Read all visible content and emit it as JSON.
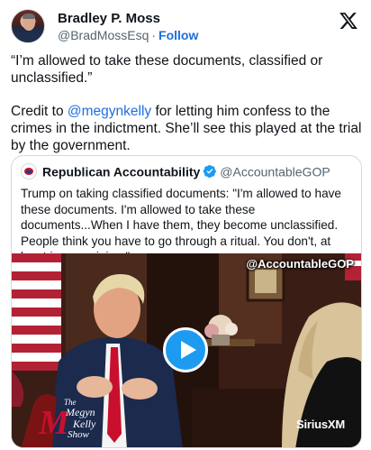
{
  "post": {
    "author_name": "Bradley P. Moss",
    "author_handle": "@BradMossEsq",
    "separator": "·",
    "follow_label": "Follow",
    "paragraph1": "“I’m allowed to take these documents, classified or unclassified.”",
    "paragraph2_prefix": "Credit to ",
    "paragraph2_mention": "@megynkelly",
    "paragraph2_suffix": " for letting him confess to the crimes in the indictment. She’ll see this played at the trial by the government."
  },
  "quoted": {
    "author_name": "Republican Accountability",
    "author_handle": "@AccountableGOP",
    "text": "Trump on taking classified documents: \"I'm allowed to have these documents. I'm allowed to take these documents...When I have them, they become unclassified. People think you have to go through a ritual. You don't, at least in my opinion.\"",
    "video": {
      "watermark": "@AccountableGOP",
      "show_logo_line1": "The",
      "show_logo_line2": "Megyn",
      "show_logo_line3": "Kelly",
      "show_logo_line4": "Show",
      "show_logo_initial": "M",
      "network_logo": "SiriusXM"
    }
  },
  "icons": {
    "platform": "x-logo-icon",
    "verified": "verified-badge-icon",
    "play": "play-icon"
  },
  "colors": {
    "link": "#1d6fe0",
    "verified": "#1d9bf0",
    "text": "#0f1419",
    "muted": "#536471"
  }
}
